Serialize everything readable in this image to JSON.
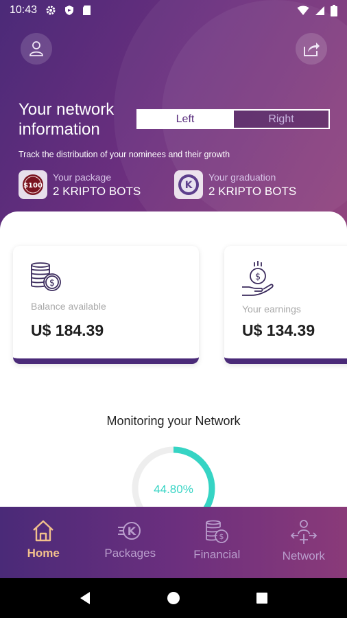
{
  "status_bar": {
    "time": "10:43"
  },
  "hero": {
    "title": "Your network information",
    "toggle": {
      "left": "Left",
      "right": "Right",
      "selected": "Left"
    },
    "subtitle": "Track the distribution of your nominees and their growth",
    "package": {
      "label": "Your package",
      "value": "2 KRIPTO BOTS",
      "badge": "$100"
    },
    "graduation": {
      "label": "Your graduation",
      "value": "2 KRIPTO BOTS",
      "badge": "K"
    }
  },
  "cards": {
    "balance": {
      "label": "Balance available",
      "value": "U$ 184.39",
      "icon": "coins-icon"
    },
    "earnings": {
      "label": "Your earnings",
      "value": "U$ 134.39",
      "icon": "hand-coin-icon"
    }
  },
  "monitoring": {
    "title": "Monitoring your Network",
    "value_text": "44.80%",
    "percent": 44.8
  },
  "bottom_nav": {
    "items": [
      {
        "label": "Home",
        "icon": "home-icon",
        "active": true
      },
      {
        "label": "Packages",
        "icon": "packages-icon",
        "active": false
      },
      {
        "label": "Financial",
        "icon": "financial-icon",
        "active": false
      },
      {
        "label": "Network",
        "icon": "network-icon",
        "active": false
      }
    ]
  },
  "colors": {
    "accent": "#4a2a78",
    "gauge": "#36d4c4",
    "active_nav": "#f2c18c"
  }
}
